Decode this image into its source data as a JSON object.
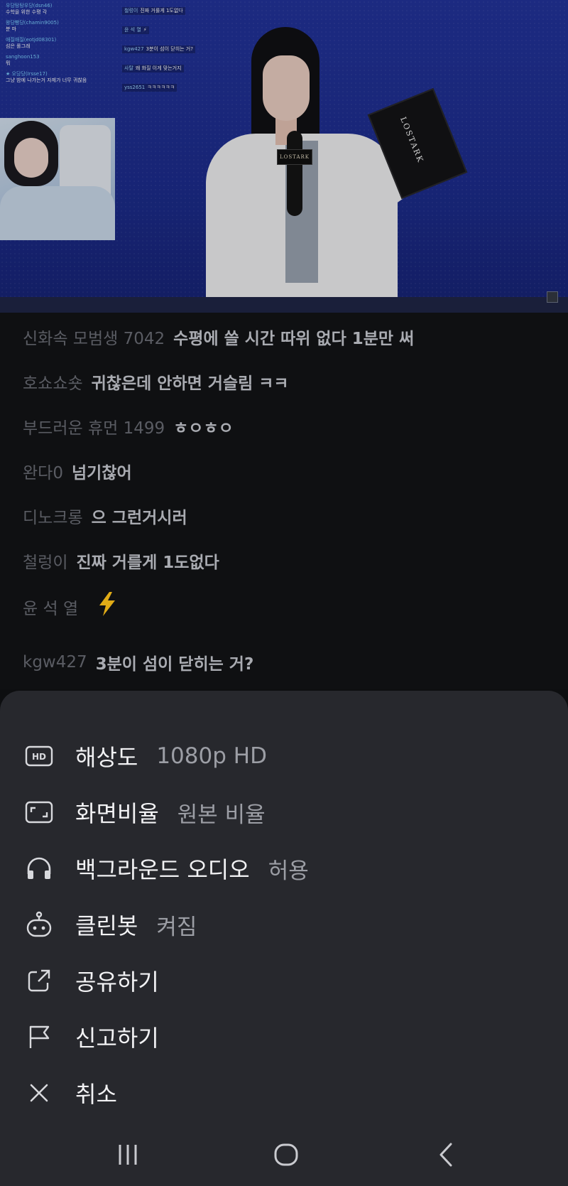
{
  "video": {
    "overlay_chat": [
      {
        "nick": "우당탕탕우당(dsn46)",
        "text": "수학을 위한 수평 각"
      },
      {
        "nick": "왕당빵당(chamin9005)",
        "text": "분 마"
      },
      {
        "nick": "애질애질(eotjd08301)",
        "text": "섬은 롤그래"
      },
      {
        "nick": "sanghoon153",
        "text": "뭐"
      },
      {
        "nick": "★ 오당당(Irsse17)",
        "text": "그냥 밤에 나가는거 자제가 너무 귀찮음"
      }
    ],
    "overlay_chat2": [
      {
        "nick": "철렁이",
        "text": "진짜 거룰게 1도없다"
      },
      {
        "nick": "윤 석 열",
        "text": "⚡"
      },
      {
        "nick": "kgw427",
        "text": "3분이 섬이 닫히는 거?"
      },
      {
        "nick": "사탈",
        "text": "왜 화질 이게 맞는거지"
      },
      {
        "nick": "yss2651",
        "text": "ㅋㅋㅋㅋㅋㅋ"
      }
    ],
    "mic_tag": "LOSTARK",
    "board_text": "LOSTARK"
  },
  "chat": [
    {
      "nick": "신화속 모범생 7042",
      "text": "수평에 쓸 시간 따위 없다 1분만 써"
    },
    {
      "nick": "호쇼쇼숏",
      "text": "귀찮은데 안하면 거슬림 ㅋㅋ"
    },
    {
      "nick": "부드러운 휴먼 1499",
      "text": "ㅎㅇㅎㅇ"
    },
    {
      "nick": "완다0",
      "text": "넘기찮어"
    },
    {
      "nick": "디노크롱",
      "text": "으 그런거시러"
    },
    {
      "nick": "철렁이",
      "text": "진짜 거를게 1도없다"
    },
    {
      "nick": "윤 석 열",
      "text": ""
    },
    {
      "nick": "kgw427",
      "text": "3분이 섬이 닫히는 거?"
    }
  ],
  "menu": {
    "resolution": {
      "label": "해상도",
      "value": "1080p HD",
      "icon": "hd-icon"
    },
    "aspect": {
      "label": "화면비율",
      "value": "원본 비율",
      "icon": "aspect-ratio-icon"
    },
    "background_audio": {
      "label": "백그라운드 오디오",
      "value": "허용",
      "icon": "headphones-icon"
    },
    "cleanbot": {
      "label": "클린봇",
      "value": "켜짐",
      "icon": "robot-icon"
    },
    "share": {
      "label": "공유하기",
      "icon": "share-icon"
    },
    "report": {
      "label": "신고하기",
      "icon": "flag-icon"
    },
    "cancel": {
      "label": "취소",
      "icon": "close-icon"
    }
  },
  "colors": {
    "sheet_bg": "#27282d",
    "chat_bg": "#0f1012",
    "video_bg": "#1d2d8f"
  }
}
